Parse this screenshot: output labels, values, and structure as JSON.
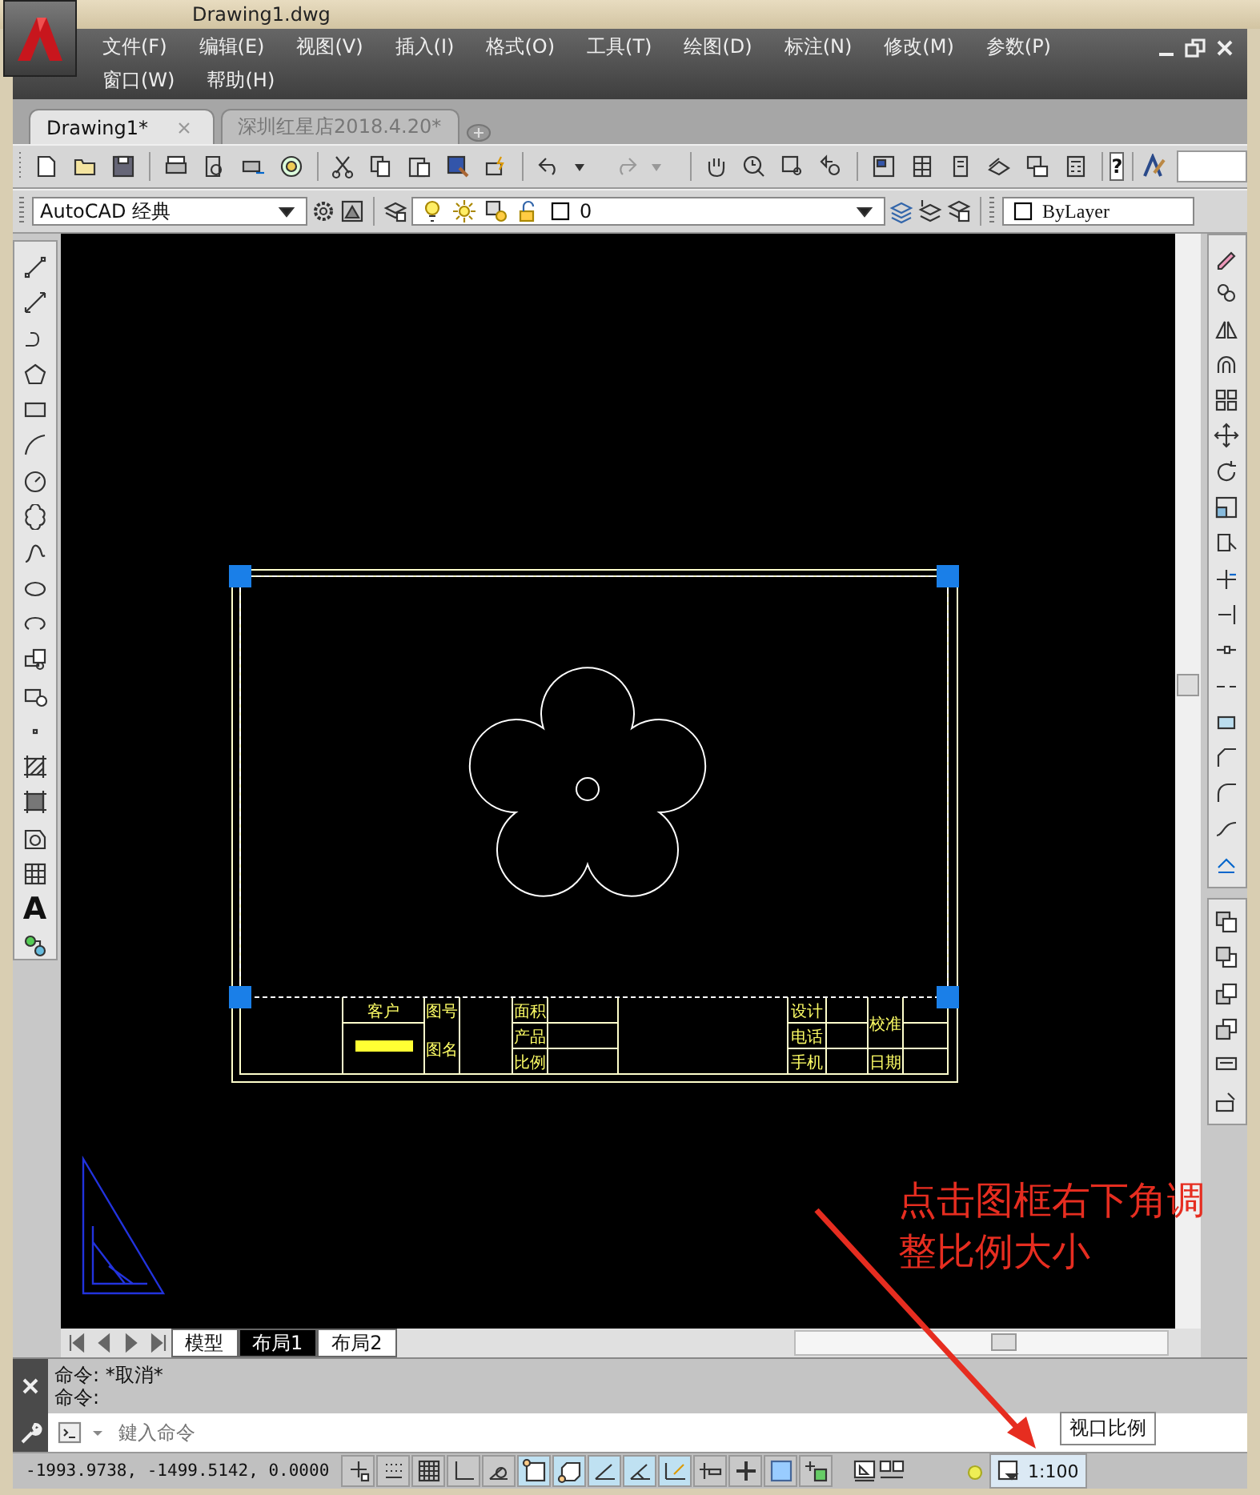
{
  "window": {
    "title": "Drawing1.dwg"
  },
  "menu_rows": [
    [
      "文件(F)",
      "编辑(E)",
      "视图(V)",
      "插入(I)",
      "格式(O)",
      "工具(T)",
      "绘图(D)",
      "标注(N)",
      "修改(M)",
      "参数(P)"
    ],
    [
      "窗口(W)",
      "帮助(H)"
    ]
  ],
  "document_tabs": [
    {
      "label": "Drawing1*",
      "selected": true
    },
    {
      "label": "深圳红星店2018.4.20*",
      "selected": false
    }
  ],
  "standard_toolbar": {
    "help_button": "?"
  },
  "workspace": {
    "value": "AutoCAD 经典"
  },
  "layer": {
    "value": "0"
  },
  "color": {
    "value": "ByLayer"
  },
  "draw_toolbar": {
    "text_tool": "A"
  },
  "title_block": {
    "cells": [
      "客户",
      "图号",
      "面积",
      "产品",
      "图名",
      "比例",
      "设计",
      "电话",
      "手机",
      "校准",
      "日期"
    ]
  },
  "layout_tabs": [
    {
      "label": "模型",
      "selected": false
    },
    {
      "label": "布局1",
      "selected": true
    },
    {
      "label": "布局2",
      "selected": false
    }
  ],
  "command_history": [
    "命令: *取消*",
    "命令:"
  ],
  "command_input": {
    "placeholder": "鍵入命令"
  },
  "tooltip": "视口比例",
  "status_bar": {
    "coordinates": "-1993.9738, -1499.5142, 0.0000",
    "toggles": [
      {
        "on": false
      },
      {
        "on": false
      },
      {
        "on": false
      },
      {
        "on": false
      },
      {
        "on": false
      },
      {
        "on": true
      },
      {
        "on": true
      },
      {
        "on": true
      },
      {
        "on": true
      },
      {
        "on": true
      },
      {
        "on": false
      },
      {
        "on": false
      },
      {
        "on": false
      },
      {
        "on": false
      }
    ],
    "viewport_scale": "1:100"
  },
  "annotation": {
    "text": "点击图框右下角调整比例大小"
  }
}
